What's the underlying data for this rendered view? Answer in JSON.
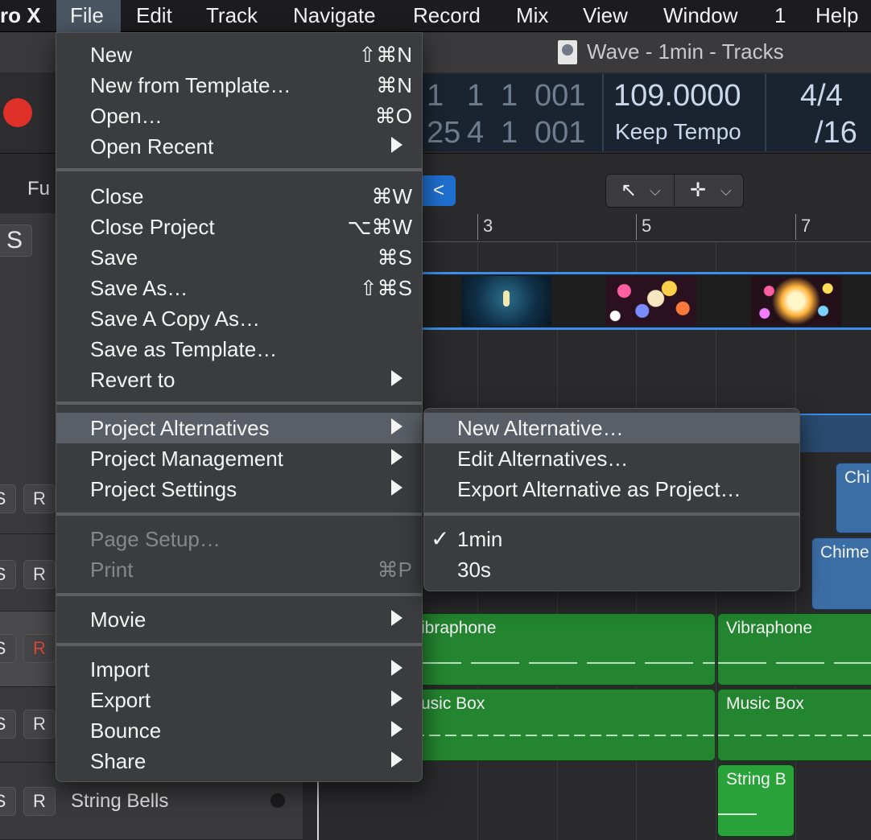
{
  "menubar": {
    "app_name": "ro X",
    "items": [
      "File",
      "Edit",
      "Track",
      "Navigate",
      "Record",
      "Mix",
      "View",
      "Window",
      "1",
      "Help"
    ]
  },
  "window": {
    "title": "Wave - 1min - Tracks"
  },
  "lcd": {
    "pos_top": [
      "1",
      "1",
      "1",
      "001",
      "1"
    ],
    "pos_bottom": [
      "25",
      "4",
      "1",
      "001"
    ],
    "tempo": "109.0000",
    "tempo_mode": "Keep Tempo",
    "signature_top": "4/4",
    "signature_bottom": "/16"
  },
  "edit_bar": {
    "functions_label": "Fu",
    "filter_glyph": "<"
  },
  "ruler": {
    "marks": [
      "3",
      "5",
      "7"
    ]
  },
  "track_headers": {
    "top_button": "S",
    "rows": [
      {
        "s": "S",
        "r": "R",
        "r_armed": false
      },
      {
        "s": "S",
        "r": "R",
        "r_armed": false
      },
      {
        "s": "S",
        "r": "R",
        "r_armed": true
      },
      {
        "s": "S",
        "r": "R",
        "r_armed": false
      },
      {
        "s": "S",
        "r": "R",
        "r_armed": false,
        "name": "String Bells"
      }
    ]
  },
  "regions": {
    "chimes_1": "Chi",
    "chimes_2": "Chime",
    "vibraphone_1": "ibraphone",
    "vibraphone_2": "Vibraphone",
    "music_box_1": "usic Box",
    "music_box_2": "Music Box",
    "string_bells": "String B"
  },
  "file_menu": {
    "new": {
      "label": "New",
      "shortcut": "⇧⌘N"
    },
    "new_from_template": {
      "label": "New from Template…",
      "shortcut": "⌘N"
    },
    "open": {
      "label": "Open…",
      "shortcut": "⌘O"
    },
    "open_recent": {
      "label": "Open Recent"
    },
    "close": {
      "label": "Close",
      "shortcut": "⌘W"
    },
    "close_project": {
      "label": "Close Project",
      "shortcut": "⌥⌘W"
    },
    "save": {
      "label": "Save",
      "shortcut": "⌘S"
    },
    "save_as": {
      "label": "Save As…",
      "shortcut": "⇧⌘S"
    },
    "save_copy_as": {
      "label": "Save A Copy As…"
    },
    "save_as_template": {
      "label": "Save as Template…"
    },
    "revert_to": {
      "label": "Revert to"
    },
    "project_alternatives": {
      "label": "Project Alternatives"
    },
    "project_management": {
      "label": "Project Management"
    },
    "project_settings": {
      "label": "Project Settings"
    },
    "page_setup": {
      "label": "Page Setup…"
    },
    "print": {
      "label": "Print",
      "shortcut": "⌘P"
    },
    "movie": {
      "label": "Movie"
    },
    "import": {
      "label": "Import"
    },
    "export": {
      "label": "Export"
    },
    "bounce": {
      "label": "Bounce"
    },
    "share": {
      "label": "Share"
    }
  },
  "alternatives_submenu": {
    "new_alternative": "New Alternative…",
    "edit_alternatives": "Edit Alternatives…",
    "export_alternative": "Export Alternative as Project…",
    "checkmark": "✓",
    "alternatives": [
      "1min",
      "30s"
    ],
    "selected": "1min"
  }
}
